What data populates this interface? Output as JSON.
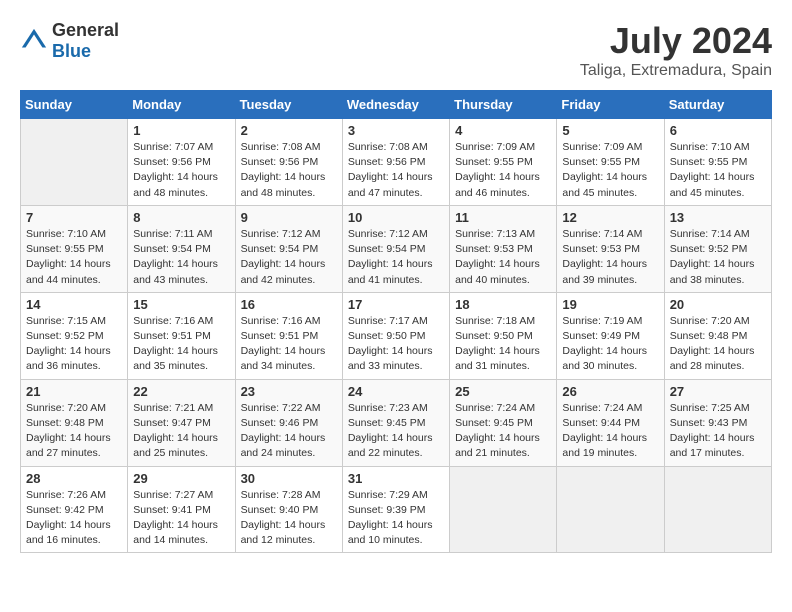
{
  "logo": {
    "general": "General",
    "blue": "Blue"
  },
  "title": "July 2024",
  "subtitle": "Taliga, Extremadura, Spain",
  "days_of_week": [
    "Sunday",
    "Monday",
    "Tuesday",
    "Wednesday",
    "Thursday",
    "Friday",
    "Saturday"
  ],
  "weeks": [
    [
      {
        "num": "",
        "info": ""
      },
      {
        "num": "1",
        "info": "Sunrise: 7:07 AM\nSunset: 9:56 PM\nDaylight: 14 hours\nand 48 minutes."
      },
      {
        "num": "2",
        "info": "Sunrise: 7:08 AM\nSunset: 9:56 PM\nDaylight: 14 hours\nand 48 minutes."
      },
      {
        "num": "3",
        "info": "Sunrise: 7:08 AM\nSunset: 9:56 PM\nDaylight: 14 hours\nand 47 minutes."
      },
      {
        "num": "4",
        "info": "Sunrise: 7:09 AM\nSunset: 9:55 PM\nDaylight: 14 hours\nand 46 minutes."
      },
      {
        "num": "5",
        "info": "Sunrise: 7:09 AM\nSunset: 9:55 PM\nDaylight: 14 hours\nand 45 minutes."
      },
      {
        "num": "6",
        "info": "Sunrise: 7:10 AM\nSunset: 9:55 PM\nDaylight: 14 hours\nand 45 minutes."
      }
    ],
    [
      {
        "num": "7",
        "info": "Sunrise: 7:10 AM\nSunset: 9:55 PM\nDaylight: 14 hours\nand 44 minutes."
      },
      {
        "num": "8",
        "info": "Sunrise: 7:11 AM\nSunset: 9:54 PM\nDaylight: 14 hours\nand 43 minutes."
      },
      {
        "num": "9",
        "info": "Sunrise: 7:12 AM\nSunset: 9:54 PM\nDaylight: 14 hours\nand 42 minutes."
      },
      {
        "num": "10",
        "info": "Sunrise: 7:12 AM\nSunset: 9:54 PM\nDaylight: 14 hours\nand 41 minutes."
      },
      {
        "num": "11",
        "info": "Sunrise: 7:13 AM\nSunset: 9:53 PM\nDaylight: 14 hours\nand 40 minutes."
      },
      {
        "num": "12",
        "info": "Sunrise: 7:14 AM\nSunset: 9:53 PM\nDaylight: 14 hours\nand 39 minutes."
      },
      {
        "num": "13",
        "info": "Sunrise: 7:14 AM\nSunset: 9:52 PM\nDaylight: 14 hours\nand 38 minutes."
      }
    ],
    [
      {
        "num": "14",
        "info": "Sunrise: 7:15 AM\nSunset: 9:52 PM\nDaylight: 14 hours\nand 36 minutes."
      },
      {
        "num": "15",
        "info": "Sunrise: 7:16 AM\nSunset: 9:51 PM\nDaylight: 14 hours\nand 35 minutes."
      },
      {
        "num": "16",
        "info": "Sunrise: 7:16 AM\nSunset: 9:51 PM\nDaylight: 14 hours\nand 34 minutes."
      },
      {
        "num": "17",
        "info": "Sunrise: 7:17 AM\nSunset: 9:50 PM\nDaylight: 14 hours\nand 33 minutes."
      },
      {
        "num": "18",
        "info": "Sunrise: 7:18 AM\nSunset: 9:50 PM\nDaylight: 14 hours\nand 31 minutes."
      },
      {
        "num": "19",
        "info": "Sunrise: 7:19 AM\nSunset: 9:49 PM\nDaylight: 14 hours\nand 30 minutes."
      },
      {
        "num": "20",
        "info": "Sunrise: 7:20 AM\nSunset: 9:48 PM\nDaylight: 14 hours\nand 28 minutes."
      }
    ],
    [
      {
        "num": "21",
        "info": "Sunrise: 7:20 AM\nSunset: 9:48 PM\nDaylight: 14 hours\nand 27 minutes."
      },
      {
        "num": "22",
        "info": "Sunrise: 7:21 AM\nSunset: 9:47 PM\nDaylight: 14 hours\nand 25 minutes."
      },
      {
        "num": "23",
        "info": "Sunrise: 7:22 AM\nSunset: 9:46 PM\nDaylight: 14 hours\nand 24 minutes."
      },
      {
        "num": "24",
        "info": "Sunrise: 7:23 AM\nSunset: 9:45 PM\nDaylight: 14 hours\nand 22 minutes."
      },
      {
        "num": "25",
        "info": "Sunrise: 7:24 AM\nSunset: 9:45 PM\nDaylight: 14 hours\nand 21 minutes."
      },
      {
        "num": "26",
        "info": "Sunrise: 7:24 AM\nSunset: 9:44 PM\nDaylight: 14 hours\nand 19 minutes."
      },
      {
        "num": "27",
        "info": "Sunrise: 7:25 AM\nSunset: 9:43 PM\nDaylight: 14 hours\nand 17 minutes."
      }
    ],
    [
      {
        "num": "28",
        "info": "Sunrise: 7:26 AM\nSunset: 9:42 PM\nDaylight: 14 hours\nand 16 minutes."
      },
      {
        "num": "29",
        "info": "Sunrise: 7:27 AM\nSunset: 9:41 PM\nDaylight: 14 hours\nand 14 minutes."
      },
      {
        "num": "30",
        "info": "Sunrise: 7:28 AM\nSunset: 9:40 PM\nDaylight: 14 hours\nand 12 minutes."
      },
      {
        "num": "31",
        "info": "Sunrise: 7:29 AM\nSunset: 9:39 PM\nDaylight: 14 hours\nand 10 minutes."
      },
      {
        "num": "",
        "info": ""
      },
      {
        "num": "",
        "info": ""
      },
      {
        "num": "",
        "info": ""
      }
    ]
  ]
}
